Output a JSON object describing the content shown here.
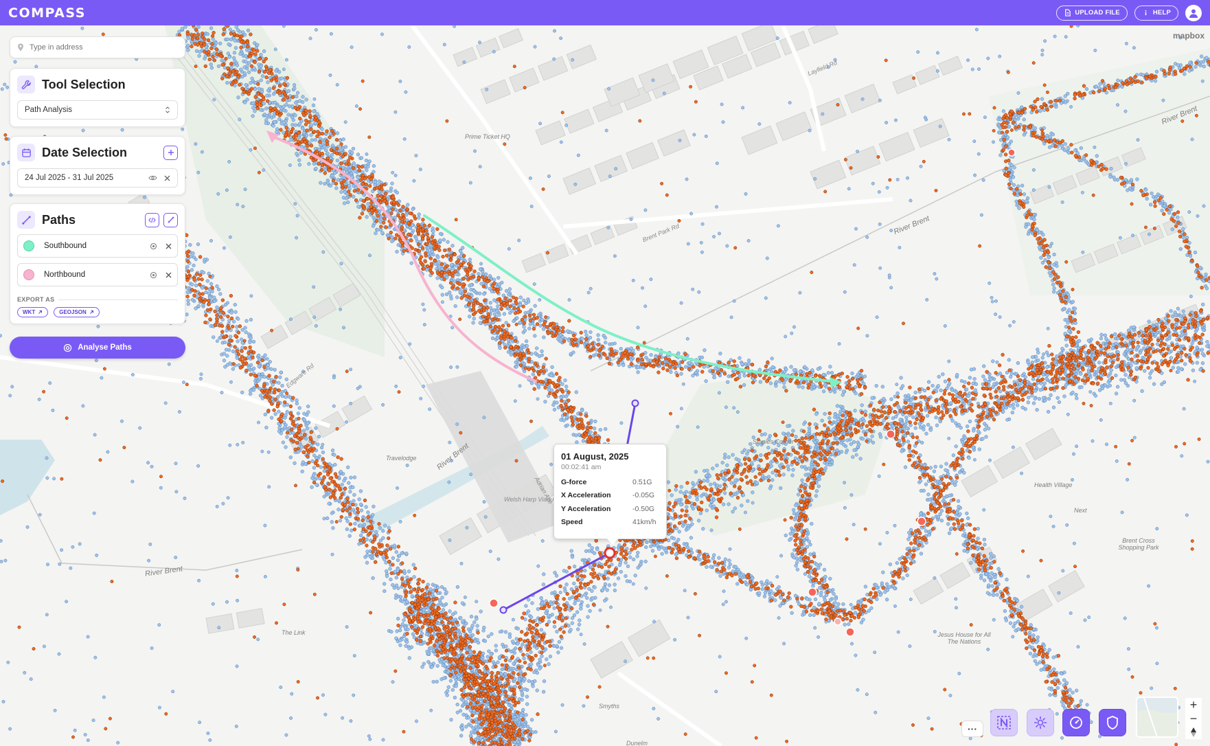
{
  "app": {
    "name": "COMPASS"
  },
  "topbar": {
    "upload_label": "UPLOAD FILE",
    "help_label": "HELP"
  },
  "search": {
    "placeholder": "Type in address"
  },
  "tool_selection": {
    "title": "Tool Selection",
    "selected": "Path Analysis"
  },
  "date_selection": {
    "title": "Date Selection",
    "range": "24 Jul 2025 - 31 Jul 2025"
  },
  "paths": {
    "title": "Paths",
    "items": [
      {
        "label": "Southbound",
        "color": "#7ef0c6"
      },
      {
        "label": "Northbound",
        "color": "#f7b3cf"
      }
    ],
    "export_label": "EXPORT AS",
    "export_options": [
      "WKT",
      "GEOJSON"
    ]
  },
  "analyse_button": "Analyse Paths",
  "tooltip": {
    "date": "01 August, 2025",
    "time": "00:02:41 am",
    "rows": [
      {
        "key": "G-force",
        "value": "0.51G"
      },
      {
        "key": "X Acceleration",
        "value": "-0.05G"
      },
      {
        "key": "Y Acceleration",
        "value": "-0.50G"
      },
      {
        "key": "Speed",
        "value": "41km/h"
      }
    ]
  },
  "map": {
    "attribution": "mapbox",
    "labels": {
      "prime_ticket": "Prime Ticket HQ",
      "brent_park_rd": "Brent Park Rd",
      "layfield_rd": "Layfield Rd",
      "river_brent_1": "River Brent",
      "river_brent_2": "River Brent",
      "river_brent_3": "River Brent",
      "river_brent_4": "River Brent",
      "travelodge": "Travelodge",
      "adrian_ave": "Adrian Ave",
      "welsh_harp": "Welsh Harp Viaduct",
      "staples_corner": "Staples Corner",
      "health_village": "Health Village",
      "next": "Next",
      "brent_cross": "Brent Cross Shopping Park",
      "jesus_house": "Jesus House for All The Nations",
      "the_link": "The Link",
      "smyths": "Smyths",
      "dunelm": "Dunelm",
      "edgware_rd": "Edgware Rd"
    }
  },
  "colors": {
    "accent": "#7a5af5",
    "points_blue": "#9cc3ee",
    "points_orange": "#f06a1e"
  },
  "tools": [
    "more-icon",
    "n-map-icon",
    "settings-icon",
    "gauge-icon",
    "shield-icon"
  ]
}
